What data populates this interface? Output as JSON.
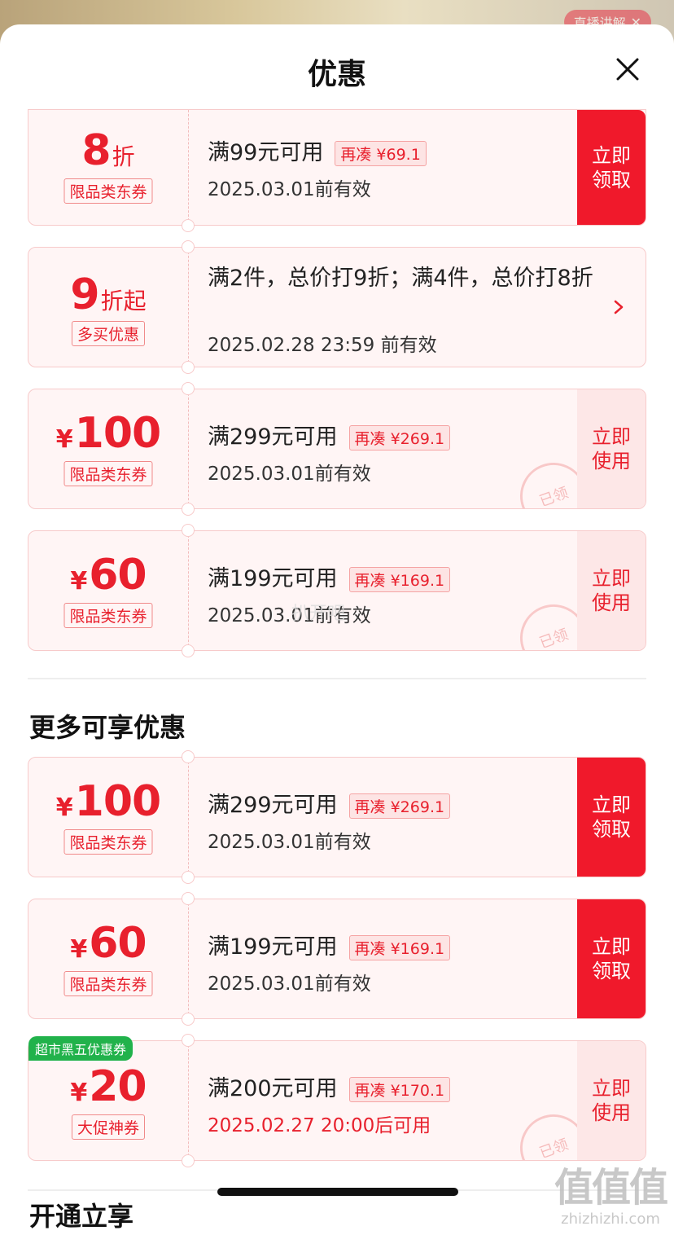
{
  "background": {
    "live_label": "直播讲解"
  },
  "sheet": {
    "title": "优惠"
  },
  "coupons": [
    {
      "type": "discount",
      "num": "8",
      "unit": "折",
      "tag": "限品类东券",
      "condition": "满99元可用",
      "more": "再凑 ¥69.1",
      "valid": "2025.03.01前有效",
      "action": "立即领取",
      "action_style": "red"
    },
    {
      "type": "multi",
      "num": "9",
      "unit": "折起",
      "tag": "多买优惠",
      "desc": "满2件，总价打9折；满4件，总价打8折",
      "valid": "2025.02.28 23:59 前有效"
    },
    {
      "type": "cash",
      "currency": "¥",
      "num": "100",
      "tag": "限品类东券",
      "condition": "满299元可用",
      "more": "再凑 ¥269.1",
      "valid": "2025.03.01前有效",
      "action": "立即使用",
      "action_style": "pale",
      "stamp": "已领"
    },
    {
      "type": "cash",
      "currency": "¥",
      "num": "60",
      "tag": "限品类东券",
      "condition": "满199元可用",
      "more": "再凑 ¥169.1",
      "valid": "2025.03.01前有效",
      "action": "立即使用",
      "action_style": "pale",
      "stamp": "已领"
    }
  ],
  "section": {
    "title": "更多可享优惠"
  },
  "more_coupons": [
    {
      "type": "cash",
      "currency": "¥",
      "num": "100",
      "tag": "限品类东券",
      "condition": "满299元可用",
      "more": "再凑 ¥269.1",
      "valid": "2025.03.01前有效",
      "action": "立即领取",
      "action_style": "red"
    },
    {
      "type": "cash",
      "currency": "¥",
      "num": "60",
      "tag": "限品类东券",
      "condition": "满199元可用",
      "more": "再凑 ¥169.1",
      "valid": "2025.03.01前有效",
      "action": "立即领取",
      "action_style": "red"
    },
    {
      "type": "cash",
      "currency": "¥",
      "num": "20",
      "badge": "超市黑五优惠券",
      "tag": "大促神券",
      "condition": "满200元可用",
      "more": "再凑 ¥170.1",
      "valid": "2025.02.27 20:00后可用",
      "valid_color": "red",
      "action": "立即使用",
      "action_style": "pale",
      "stamp": "已领"
    }
  ],
  "footer": {
    "partial_text": "开通立享"
  },
  "watermark": {
    "logo": "值值值",
    "site": "zhizhizhi.com",
    "center_mark": "扒开吧"
  },
  "colors": {
    "brand_red": "#f0192b",
    "coupon_bg": "#fff5f5",
    "coupon_border": "#f7caca",
    "badge_green": "#21b24b"
  }
}
